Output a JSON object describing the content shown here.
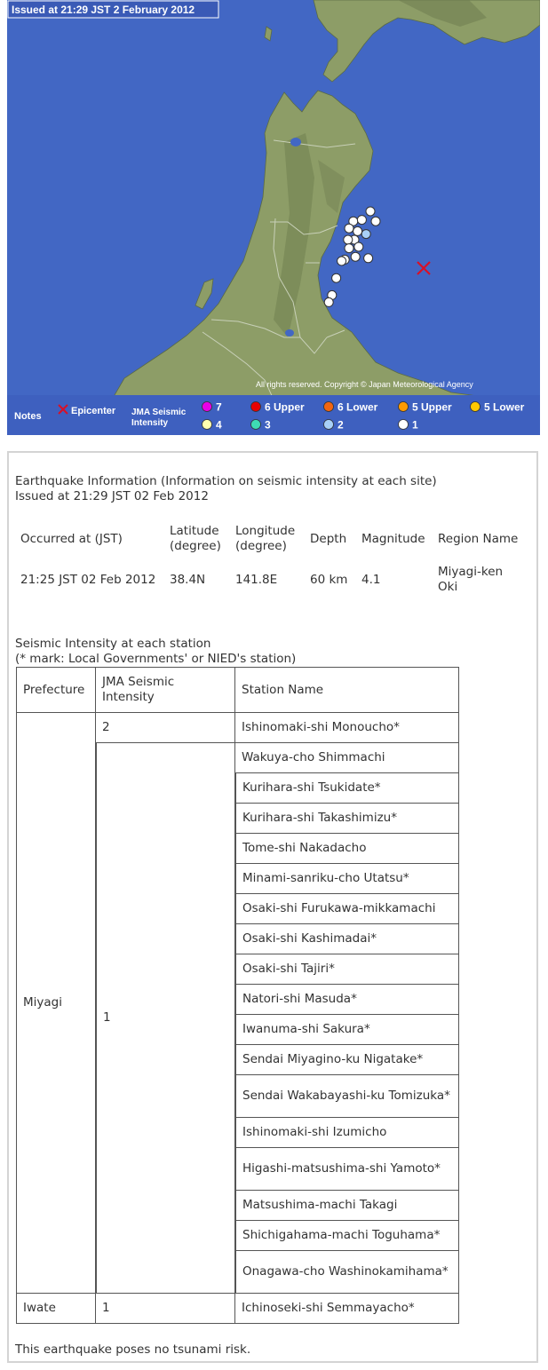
{
  "map": {
    "issued_banner": "Issued at 21:29 JST  2 February 2012",
    "copyright": "All rights reserved. Copyright © Japan Meteorological Agency",
    "epicenter": {
      "lat": 38.4,
      "lon": 141.8
    },
    "stations_on_map": [
      {
        "lon": 141.3,
        "lat": 38.8,
        "intensity": "1"
      },
      {
        "lon": 141.14,
        "lat": 38.73,
        "intensity": "1"
      },
      {
        "lon": 141.22,
        "lat": 38.74,
        "intensity": "1"
      },
      {
        "lon": 141.35,
        "lat": 38.73,
        "intensity": "1"
      },
      {
        "lon": 141.1,
        "lat": 38.68,
        "intensity": "1"
      },
      {
        "lon": 141.18,
        "lat": 38.66,
        "intensity": "1"
      },
      {
        "lon": 141.26,
        "lat": 38.64,
        "intensity": "2"
      },
      {
        "lon": 141.15,
        "lat": 38.6,
        "intensity": "1"
      },
      {
        "lon": 141.09,
        "lat": 38.6,
        "intensity": "1"
      },
      {
        "lon": 141.19,
        "lat": 38.55,
        "intensity": "1"
      },
      {
        "lon": 141.1,
        "lat": 38.54,
        "intensity": "1"
      },
      {
        "lon": 141.28,
        "lat": 38.47,
        "intensity": "1"
      },
      {
        "lon": 141.16,
        "lat": 38.48,
        "intensity": "1"
      },
      {
        "lon": 141.06,
        "lat": 38.46,
        "intensity": "1"
      },
      {
        "lon": 141.03,
        "lat": 38.45,
        "intensity": "1"
      },
      {
        "lon": 140.98,
        "lat": 38.33,
        "intensity": "1"
      },
      {
        "lon": 140.94,
        "lat": 38.21,
        "intensity": "1"
      },
      {
        "lon": 140.91,
        "lat": 38.16,
        "intensity": "1"
      }
    ],
    "legend": {
      "notes": "Notes",
      "epicenter": "Epicenter",
      "scale_title": "JMA Seismic\nIntensity",
      "items": [
        {
          "label": "7",
          "color": "#e800e8"
        },
        {
          "label": "6 Upper",
          "color": "#e80000"
        },
        {
          "label": "6 Lower",
          "color": "#f26510"
        },
        {
          "label": "5 Upper",
          "color": "#ff9a00"
        },
        {
          "label": "5 Lower",
          "color": "#ffc800"
        },
        {
          "label": "4",
          "color": "#ffffb0"
        },
        {
          "label": "3",
          "color": "#3edcb4"
        },
        {
          "label": "2",
          "color": "#a8d0f8"
        },
        {
          "label": "1",
          "color": "#ffffff"
        }
      ]
    },
    "colors": {
      "sea": "#4267c4",
      "land": "#8d9d67",
      "mountain": "#717f51",
      "legend_bar": "#3e60bf",
      "epicenter": "#d81027"
    }
  },
  "info": {
    "title": "Earthquake Information (Information on seismic intensity at each site)",
    "issued": "Issued at 21:29 JST 02 Feb 2012",
    "headers": [
      "Occurred at (JST)",
      "Latitude (degree)",
      "Longitude (degree)",
      "Depth",
      "Magnitude",
      "Region Name"
    ],
    "values": [
      "21:25 JST 02 Feb 2012",
      "38.4N",
      "141.8E",
      "60 km",
      "4.1",
      "Miyagi-ken Oki"
    ]
  },
  "stations": {
    "caption_line1": "Seismic Intensity at each station",
    "caption_line2": "(* mark: Local Governments' or NIED's station)",
    "headers": [
      "Prefecture",
      "JMA Seismic Intensity",
      "Station Name"
    ],
    "groups": [
      {
        "prefecture": "Miyagi",
        "intensities": [
          {
            "level": "2",
            "stations": [
              "Ishinomaki-shi Monoucho*"
            ]
          },
          {
            "level": "1",
            "stations": [
              "Wakuya-cho Shimmachi",
              "Kurihara-shi Tsukidate*",
              "Kurihara-shi Takashimizu*",
              "Tome-shi Nakadacho",
              "Minami-sanriku-cho Utatsu*",
              "Osaki-shi Furukawa-mikkamachi",
              "Osaki-shi Kashimadai*",
              "Osaki-shi Tajiri*",
              "Natori-shi Masuda*",
              "Iwanuma-shi Sakura*",
              "Sendai Miyagino-ku Nigatake*",
              "Sendai Wakabayashi-ku Tomizuka*",
              "Ishinomaki-shi Izumicho",
              "Higashi-matsushima-shi Yamoto*",
              "Matsushima-machi Takagi",
              "Shichigahama-machi Toguhama*",
              "Onagawa-cho Washinokamihama*"
            ]
          }
        ]
      },
      {
        "prefecture": "Iwate",
        "intensities": [
          {
            "level": "1",
            "stations": [
              "Ichinoseki-shi Semmayacho*"
            ]
          }
        ]
      }
    ]
  },
  "footer": {
    "tsunami": "This earthquake poses no tsunami risk."
  }
}
